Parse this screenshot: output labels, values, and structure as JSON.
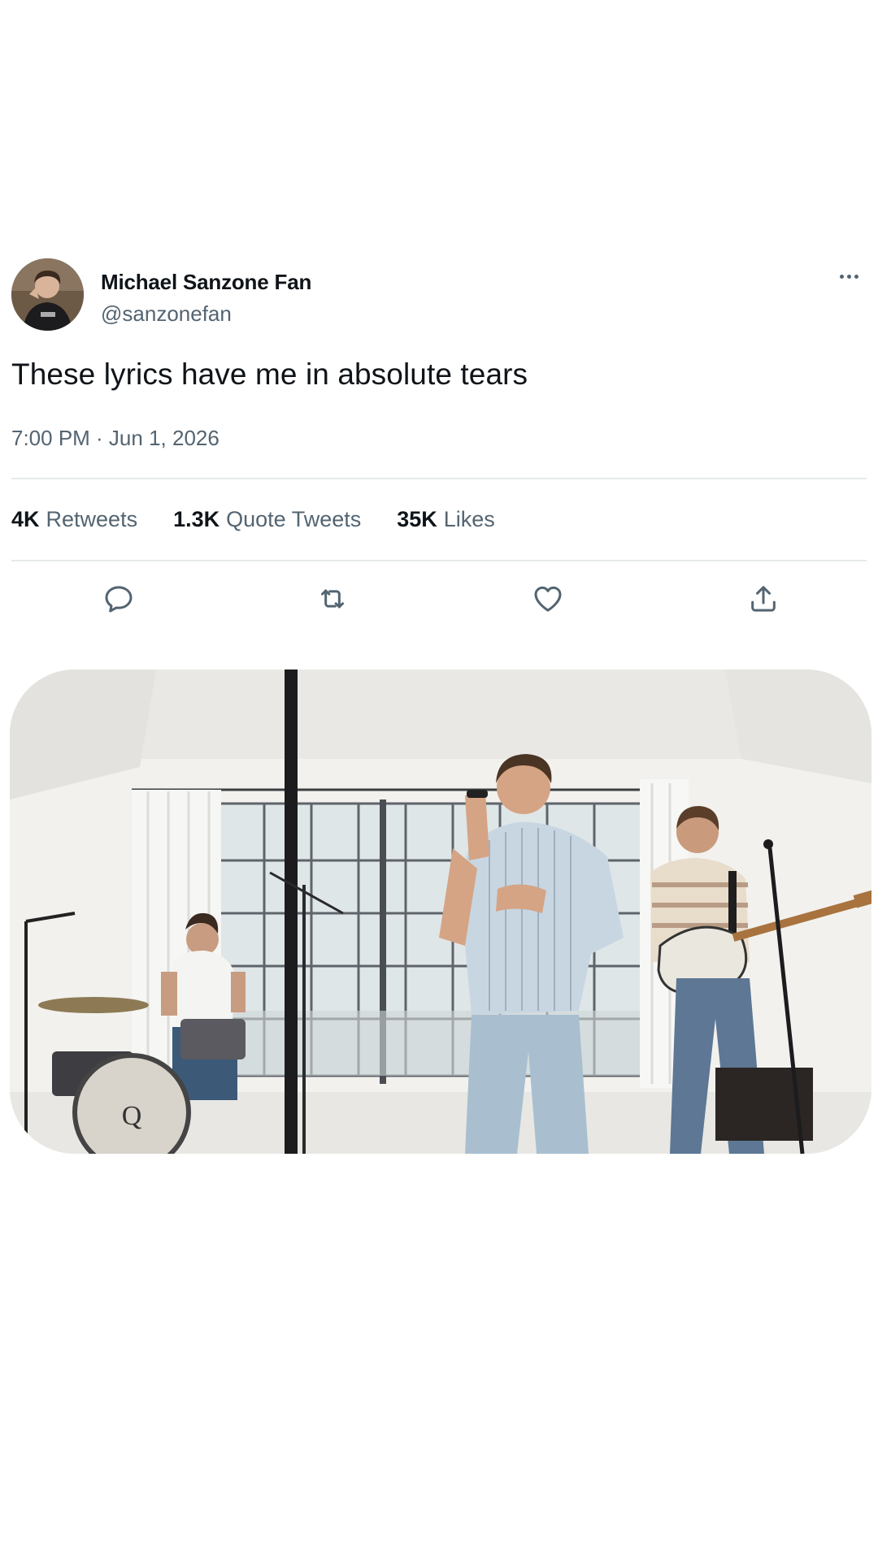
{
  "tweet": {
    "display_name": "Michael Sanzone Fan",
    "handle": "@sanzonefan",
    "text": "These lyrics have me in absolute tears",
    "timestamp": "7:00 PM · Jun 1, 2026"
  },
  "stats": {
    "retweets": {
      "count": "4K",
      "label": "Retweets"
    },
    "quotes": {
      "count": "1.3K",
      "label": "Quote Tweets"
    },
    "likes": {
      "count": "35K",
      "label": "Likes"
    }
  },
  "actions": {
    "reply_icon": "reply-icon",
    "retweet_icon": "retweet-icon",
    "like_icon": "heart-icon",
    "share_icon": "share-icon"
  },
  "colors": {
    "text_primary": "#0f1419",
    "text_secondary": "#536471",
    "divider": "#e6e9eb"
  }
}
